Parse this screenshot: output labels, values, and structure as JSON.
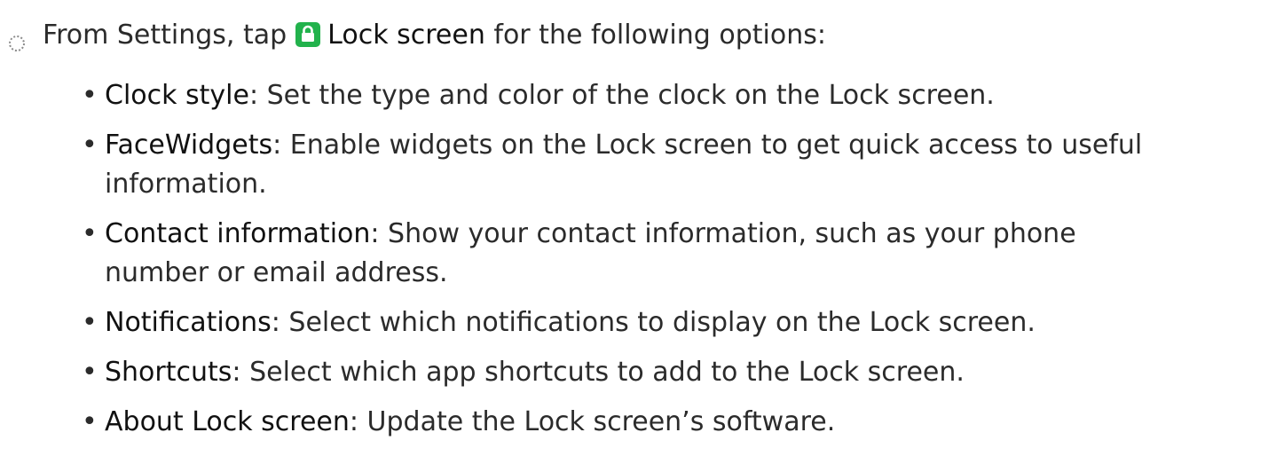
{
  "step": {
    "prefix": "From Settings, tap",
    "icon": "lock-icon",
    "icon_color": "#22b24c",
    "label": "Lock screen",
    "suffix": "for the following options:"
  },
  "items": [
    {
      "term": "Clock style",
      "description": ": Set the type and color of the clock on the Lock screen."
    },
    {
      "term": "FaceWidgets",
      "description": ": Enable widgets on the Lock screen to get quick access to useful",
      "description_cont": "information."
    },
    {
      "term": "Contact information",
      "description": ": Show your contact information, such as your phone",
      "description_cont": "number or email address."
    },
    {
      "term": "Notifications",
      "description": ": Select which notifications to display on the Lock screen."
    },
    {
      "term": "Shortcuts",
      "description": ": Select which app shortcuts to add to the Lock screen."
    },
    {
      "term": "About Lock screen",
      "description": ": Update the Lock screen’s software."
    }
  ]
}
